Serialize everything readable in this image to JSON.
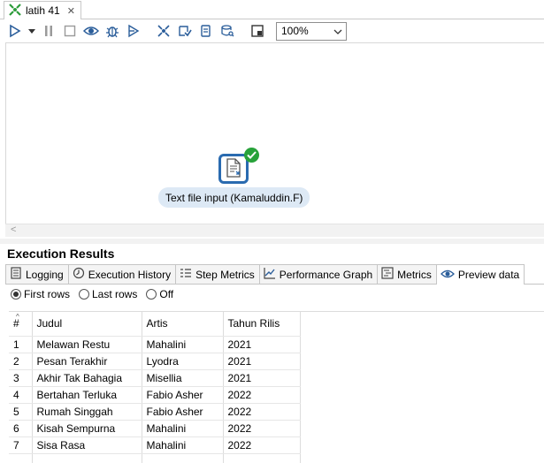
{
  "window": {
    "tab_title": "latih 41",
    "close_glyph": "✕"
  },
  "toolbar": {
    "buttons": [
      {
        "name": "run-icon"
      },
      {
        "name": "run-dropdown-icon"
      },
      {
        "name": "pause-icon"
      },
      {
        "name": "stop-icon"
      },
      {
        "name": "preview-icon"
      },
      {
        "name": "debug-icon"
      },
      {
        "name": "replay-icon"
      },
      {
        "name": "verify-icon"
      },
      {
        "name": "impact-icon"
      },
      {
        "name": "sql-icon"
      },
      {
        "name": "explore-db-icon"
      },
      {
        "name": "show-results-icon"
      }
    ],
    "zoom_value": "100%"
  },
  "canvas": {
    "step_label": "Text file input (Kamaluddin.F)",
    "scroll_left_glyph": "<"
  },
  "results": {
    "title": "Execution Results",
    "tabs": [
      {
        "label": "Logging",
        "icon": "log-icon",
        "active": false
      },
      {
        "label": "Execution History",
        "icon": "history-icon",
        "active": false
      },
      {
        "label": "Step Metrics",
        "icon": "metrics-list-icon",
        "active": false
      },
      {
        "label": "Performance Graph",
        "icon": "graph-icon",
        "active": false
      },
      {
        "label": "Metrics",
        "icon": "metrics-icon",
        "active": false
      },
      {
        "label": "Preview data",
        "icon": "eye-icon",
        "active": true
      }
    ],
    "radio_options": [
      {
        "label": "First rows",
        "checked": true
      },
      {
        "label": "Last rows",
        "checked": false
      },
      {
        "label": "Off",
        "checked": false
      }
    ],
    "table": {
      "sort_glyph": "^",
      "columns": [
        "#",
        "Judul",
        "Artis",
        "Tahun Rilis"
      ],
      "rows": [
        [
          "1",
          "Melawan Restu",
          "Mahalini",
          "2021"
        ],
        [
          "2",
          "Pesan Terakhir",
          "Lyodra",
          "2021"
        ],
        [
          "3",
          "Akhir Tak Bahagia",
          "Misellia",
          "2021"
        ],
        [
          "4",
          "Bertahan Terluka",
          "Fabio Asher",
          "2022"
        ],
        [
          "5",
          "Rumah Singgah",
          "Fabio Asher",
          "2022"
        ],
        [
          "6",
          "Kisah Sempurna",
          "Mahalini",
          "2022"
        ],
        [
          "7",
          "Sisa Rasa",
          "Mahalini",
          "2022"
        ]
      ]
    }
  },
  "colors": {
    "step_border": "#2a6bb0",
    "check_green": "#27a23a",
    "label_bg": "#dde9f5"
  }
}
